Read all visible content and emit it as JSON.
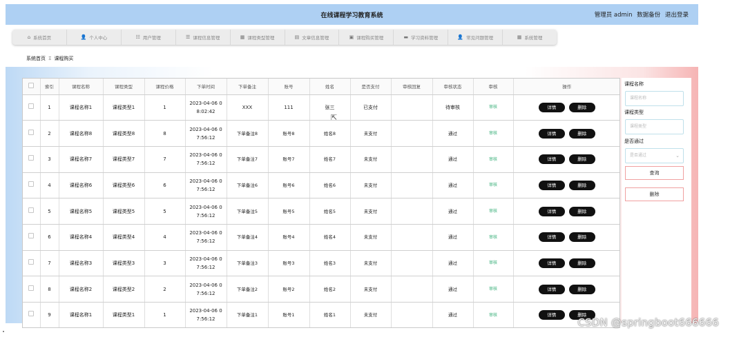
{
  "header": {
    "title": "在线课程学习教育系统",
    "user_label": "管理员 admin",
    "backup_label": "数据备份",
    "logout_label": "退出登录"
  },
  "nav": [
    {
      "icon": "home-icon",
      "glyph": "⌂",
      "label": "系统首页"
    },
    {
      "icon": "user-icon",
      "glyph": "👤",
      "label": "个人中心"
    },
    {
      "icon": "users-icon",
      "glyph": "☷",
      "label": "用户管理"
    },
    {
      "icon": "list-icon",
      "glyph": "☰",
      "label": "课程信息管理"
    },
    {
      "icon": "grid-icon",
      "glyph": "▦",
      "label": "课程类型管理"
    },
    {
      "icon": "article-icon",
      "glyph": "▤",
      "label": "文章信息管理"
    },
    {
      "icon": "cart-icon",
      "glyph": "▣",
      "label": "课程购买管理"
    },
    {
      "icon": "material-icon",
      "glyph": "▬",
      "label": "学习资料管理"
    },
    {
      "icon": "question-icon",
      "glyph": "👤",
      "label": "常见问题管理"
    },
    {
      "icon": "settings-icon",
      "glyph": "▦",
      "label": "系统管理"
    }
  ],
  "breadcrumb": {
    "home": "系统首页",
    "separator": "Ξ",
    "current": "课程购买"
  },
  "table": {
    "headers": [
      "",
      "索引",
      "课程名称",
      "课程类型",
      "课程价格",
      "下单时间",
      "下单备注",
      "账号",
      "姓名",
      "是否支付",
      "审核回复",
      "审核状态",
      "审核",
      "操作"
    ],
    "rows": [
      {
        "index": "1",
        "name": "课程名称1",
        "type": "课程类型1",
        "price": "1",
        "time1": "2023-04-06 0",
        "time2": "8:02:42",
        "note": "XXX",
        "account": "111",
        "person": "张三",
        "paid": "已支付",
        "reply": "",
        "status": "待审核",
        "audit": "审核"
      },
      {
        "index": "2",
        "name": "课程名称8",
        "type": "课程类型8",
        "price": "8",
        "time1": "2023-04-06 0",
        "time2": "7:56:12",
        "note": "下单备注8",
        "account": "账号8",
        "person": "姓名8",
        "paid": "未支付",
        "reply": "",
        "status": "通过",
        "audit": "审核"
      },
      {
        "index": "3",
        "name": "课程名称7",
        "type": "课程类型7",
        "price": "7",
        "time1": "2023-04-06 0",
        "time2": "7:56:12",
        "note": "下单备注7",
        "account": "账号7",
        "person": "姓名7",
        "paid": "未支付",
        "reply": "",
        "status": "通过",
        "audit": "审核"
      },
      {
        "index": "4",
        "name": "课程名称6",
        "type": "课程类型6",
        "price": "6",
        "time1": "2023-04-06 0",
        "time2": "7:56:12",
        "note": "下单备注6",
        "account": "账号6",
        "person": "姓名6",
        "paid": "未支付",
        "reply": "",
        "status": "通过",
        "audit": "审核"
      },
      {
        "index": "5",
        "name": "课程名称5",
        "type": "课程类型5",
        "price": "5",
        "time1": "2023-04-06 0",
        "time2": "7:56:12",
        "note": "下单备注5",
        "account": "账号5",
        "person": "姓名5",
        "paid": "未支付",
        "reply": "",
        "status": "通过",
        "audit": "审核"
      },
      {
        "index": "6",
        "name": "课程名称4",
        "type": "课程类型4",
        "price": "4",
        "time1": "2023-04-06 0",
        "time2": "7:56:12",
        "note": "下单备注4",
        "account": "账号4",
        "person": "姓名4",
        "paid": "未支付",
        "reply": "",
        "status": "通过",
        "audit": "审核"
      },
      {
        "index": "7",
        "name": "课程名称3",
        "type": "课程类型3",
        "price": "3",
        "time1": "2023-04-06 0",
        "time2": "7:56:12",
        "note": "下单备注3",
        "account": "账号3",
        "person": "姓名3",
        "paid": "未支付",
        "reply": "",
        "status": "通过",
        "audit": "审核"
      },
      {
        "index": "8",
        "name": "课程名称2",
        "type": "课程类型2",
        "price": "2",
        "time1": "2023-04-06 0",
        "time2": "7:56:12",
        "note": "下单备注2",
        "account": "账号2",
        "person": "姓名2",
        "paid": "未支付",
        "reply": "",
        "status": "通过",
        "audit": "审核"
      },
      {
        "index": "9",
        "name": "课程名称1",
        "type": "课程类型1",
        "price": "1",
        "time1": "2023-04-06 0",
        "time2": "7:56:12",
        "note": "下单备注1",
        "account": "账号1",
        "person": "姓名1",
        "paid": "未支付",
        "reply": "",
        "status": "通过",
        "audit": "审核"
      }
    ],
    "detail_label": "详情",
    "delete_label": "删除"
  },
  "search": {
    "name_label": "课程名称",
    "name_placeholder": "课程名称",
    "type_label": "课程类型",
    "type_placeholder": "课程类型",
    "pass_label": "是否通过",
    "pass_placeholder": "是否通过",
    "query_label": "查询",
    "delete_label": "删除"
  },
  "watermark": "CSDN @springboot666666",
  "colors": {
    "header_bg": "#aed0f3",
    "button_bg": "#111111",
    "audit_link": "#3bb07a",
    "search_button_border": "#f0a0a0",
    "band_left": "#bdd9f5",
    "band_right": "#f6b4b4"
  }
}
